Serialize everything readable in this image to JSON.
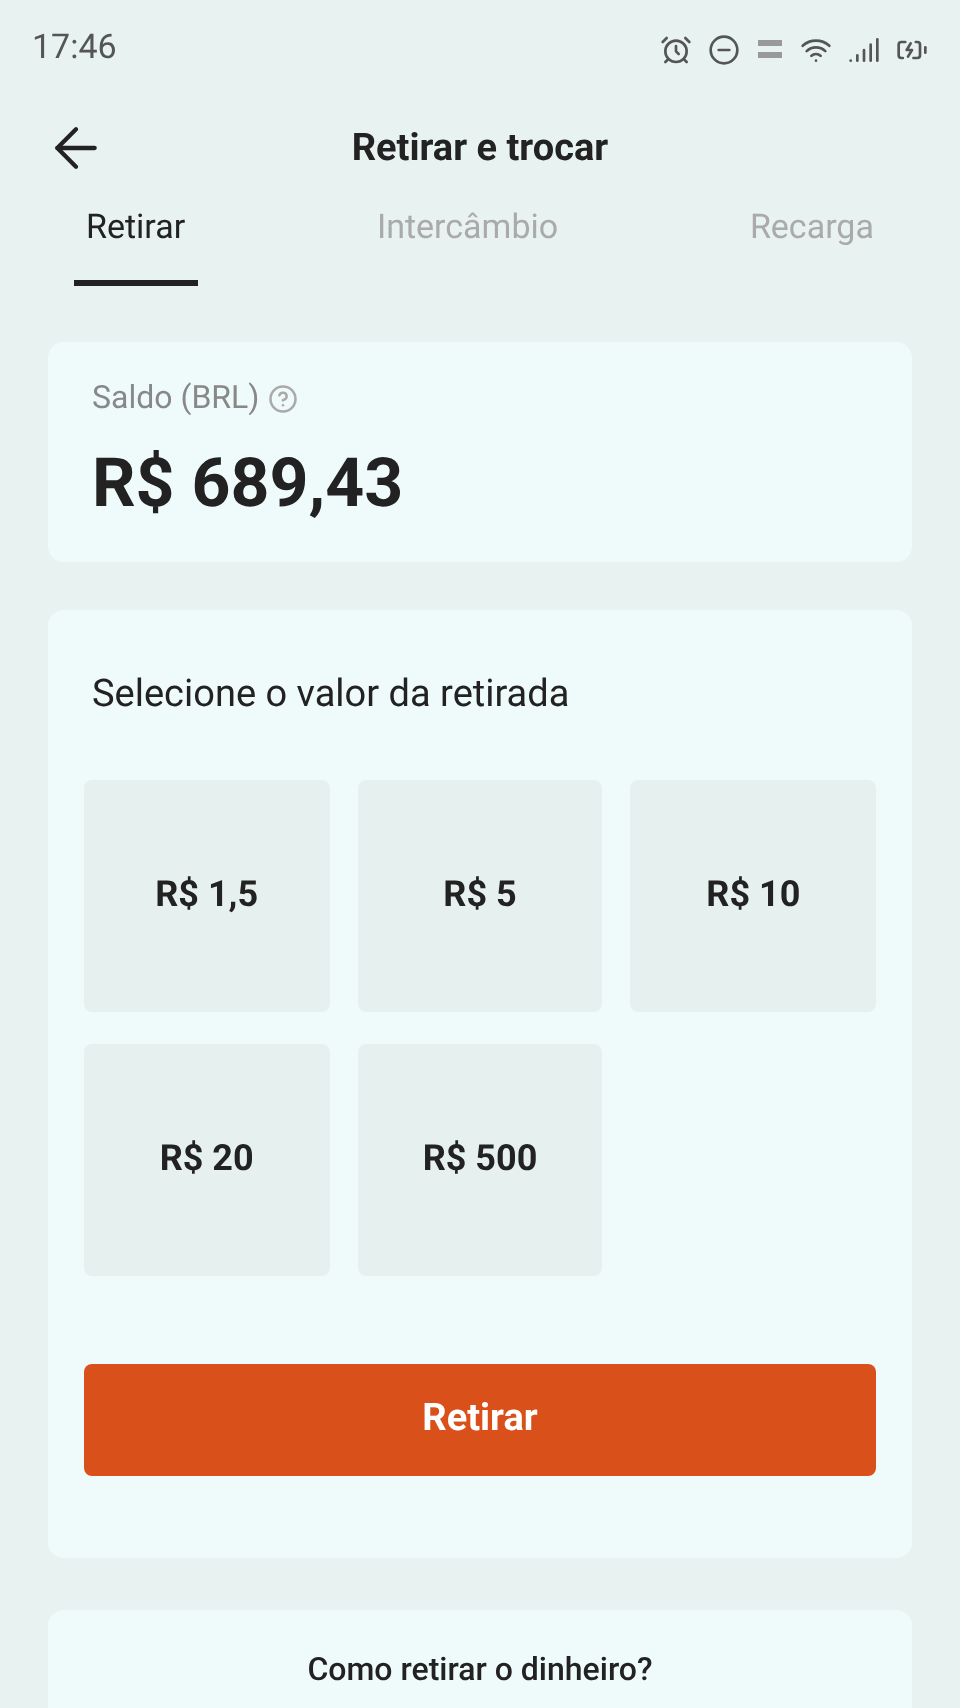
{
  "status_bar": {
    "time": "17:46"
  },
  "header": {
    "title": "Retirar e trocar"
  },
  "tabs": [
    {
      "label": "Retirar",
      "selected": true
    },
    {
      "label": "Intercâmbio",
      "selected": false
    },
    {
      "label": "Recarga",
      "selected": false
    }
  ],
  "balance": {
    "label": "Saldo (BRL)",
    "amount": "R$ 689,43"
  },
  "withdraw": {
    "prompt": "Selecione o valor da retirada",
    "amounts": [
      {
        "label": "R$ 1,5",
        "selected": false
      },
      {
        "label": "R$ 5",
        "selected": false
      },
      {
        "label": "R$ 10",
        "selected": false
      },
      {
        "label": "R$ 20",
        "selected": false
      },
      {
        "label": "R$ 500",
        "selected": false
      }
    ],
    "button": "Retirar"
  },
  "help": {
    "title": "Como retirar o dinheiro?"
  }
}
